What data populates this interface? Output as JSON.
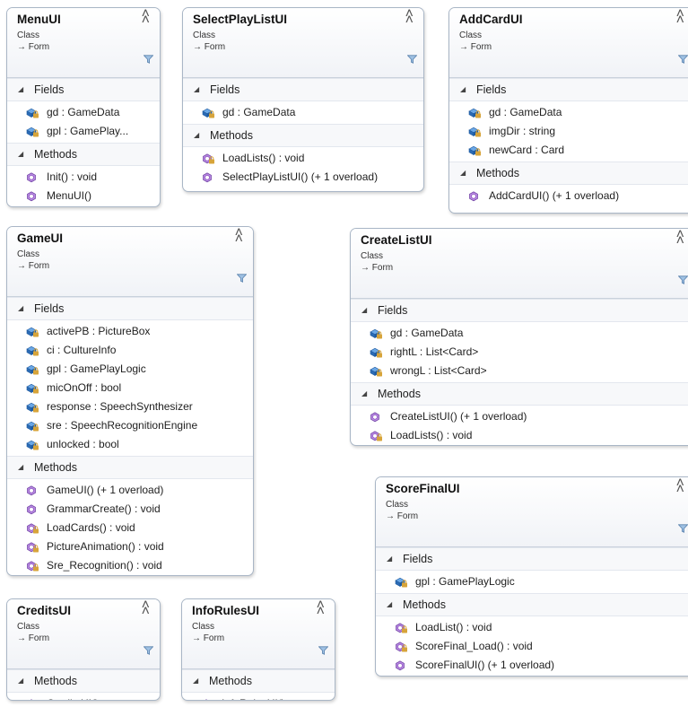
{
  "colors": {
    "field": "#2b6bb5",
    "method": "#8b4fc2",
    "lock": "#d7a43a"
  },
  "classes": [
    {
      "name": "MenuUI",
      "stereotype": "Class",
      "base": "Form",
      "fields_label": "Fields",
      "methods_label": "Methods",
      "fields": [
        {
          "label": "gd : GameData",
          "private": true
        },
        {
          "label": "gpl : GamePlay...",
          "private": true
        }
      ],
      "methods": [
        {
          "label": "Init() : void",
          "private": false
        },
        {
          "label": "MenuUI()",
          "private": false
        }
      ]
    },
    {
      "name": "SelectPlayListUI",
      "stereotype": "Class",
      "base": "Form",
      "fields_label": "Fields",
      "methods_label": "Methods",
      "fields": [
        {
          "label": "gd : GameData",
          "private": true
        }
      ],
      "methods": [
        {
          "label": "LoadLists() : void",
          "private": true
        },
        {
          "label": "SelectPlayListUI() (+ 1 overload)",
          "private": false
        }
      ]
    },
    {
      "name": "AddCardUI",
      "stereotype": "Class",
      "base": "Form",
      "fields_label": "Fields",
      "methods_label": "Methods",
      "fields": [
        {
          "label": "gd : GameData",
          "private": true
        },
        {
          "label": "imgDir : string",
          "private": true
        },
        {
          "label": "newCard : Card",
          "private": true
        }
      ],
      "methods": [
        {
          "label": "AddCardUI() (+ 1 overload)",
          "private": false
        }
      ]
    },
    {
      "name": "GameUI",
      "stereotype": "Class",
      "base": "Form",
      "fields_label": "Fields",
      "methods_label": "Methods",
      "fields": [
        {
          "label": "activePB : PictureBox",
          "private": true
        },
        {
          "label": "ci : CultureInfo",
          "private": true
        },
        {
          "label": "gpl : GamePlayLogic",
          "private": true
        },
        {
          "label": "micOnOff : bool",
          "private": true
        },
        {
          "label": "response : SpeechSynthesizer",
          "private": true
        },
        {
          "label": "sre : SpeechRecognitionEngine",
          "private": true
        },
        {
          "label": "unlocked : bool",
          "private": true
        }
      ],
      "methods": [
        {
          "label": "GameUI() (+ 1 overload)",
          "private": false
        },
        {
          "label": "GrammarCreate() : void",
          "private": false
        },
        {
          "label": "LoadCards() : void",
          "private": true
        },
        {
          "label": "PictureAnimation() : void",
          "private": true
        },
        {
          "label": "Sre_Recognition() : void",
          "private": true
        }
      ]
    },
    {
      "name": "CreateListUI",
      "stereotype": "Class",
      "base": "Form",
      "fields_label": "Fields",
      "methods_label": "Methods",
      "fields": [
        {
          "label": "gd : GameData",
          "private": true
        },
        {
          "label": "rightL : List<Card>",
          "private": true
        },
        {
          "label": "wrongL : List<Card>",
          "private": true
        }
      ],
      "methods": [
        {
          "label": "CreateListUI() (+ 1 overload)",
          "private": false
        },
        {
          "label": "LoadLists() : void",
          "private": true
        }
      ]
    },
    {
      "name": "ScoreFinalUI",
      "stereotype": "Class",
      "base": "Form",
      "fields_label": "Fields",
      "methods_label": "Methods",
      "fields": [
        {
          "label": "gpl : GamePlayLogic",
          "private": true
        }
      ],
      "methods": [
        {
          "label": "LoadList() : void",
          "private": true
        },
        {
          "label": "ScoreFinal_Load() : void",
          "private": true
        },
        {
          "label": "ScoreFinalUI() (+ 1 overload)",
          "private": false
        }
      ]
    },
    {
      "name": "CreditsUI",
      "stereotype": "Class",
      "base": "Form",
      "fields_label": "",
      "methods_label": "Methods",
      "fields": [],
      "methods": [
        {
          "label": "CreditsUI()",
          "private": false
        }
      ]
    },
    {
      "name": "InfoRulesUI",
      "stereotype": "Class",
      "base": "Form",
      "fields_label": "",
      "methods_label": "Methods",
      "fields": [],
      "methods": [
        {
          "label": "InfoRulesUI()",
          "private": false
        }
      ]
    }
  ]
}
